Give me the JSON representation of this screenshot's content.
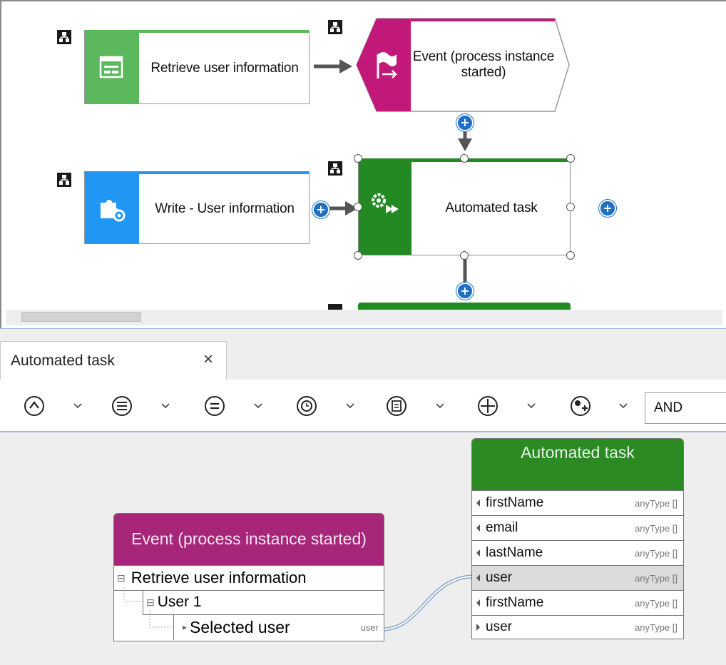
{
  "process": {
    "nodes": {
      "retrieve": {
        "label": "Retrieve user information",
        "color": "#5cb85c"
      },
      "event": {
        "label": "Event (process instance started)",
        "color": "#c2187a"
      },
      "write": {
        "label": "Write - User information",
        "color": "#2196f3"
      },
      "automated": {
        "label": "Automated task",
        "color": "#238a23"
      }
    }
  },
  "tab": {
    "label": "Automated task",
    "close": "×"
  },
  "toolbar": {
    "buttons": [
      "caret-up-icon",
      "list-icon",
      "equals-icon",
      "clock-icon",
      "document-icon",
      "plus-circle-icon",
      "star-plus-icon"
    ],
    "operator_value": "AND"
  },
  "mapping": {
    "source": {
      "title": "Event (process instance started)",
      "color": "#a8267a",
      "tree": [
        {
          "label": "Retrieve user information",
          "expander": "⊟"
        },
        {
          "label": "User 1",
          "expander": "⊟"
        },
        {
          "label": "Selected user",
          "type": "user"
        }
      ]
    },
    "target": {
      "title": "Automated task",
      "color": "#2b8a22",
      "rows": [
        {
          "label": "firstName",
          "type": "anyType []"
        },
        {
          "label": "email",
          "type": "anyType []"
        },
        {
          "label": "lastName",
          "type": "anyType []"
        },
        {
          "label": "user",
          "type": "anyType []"
        },
        {
          "label": "firstName",
          "type": "anyType []"
        },
        {
          "label": "user",
          "type": "anyType []"
        }
      ]
    }
  }
}
